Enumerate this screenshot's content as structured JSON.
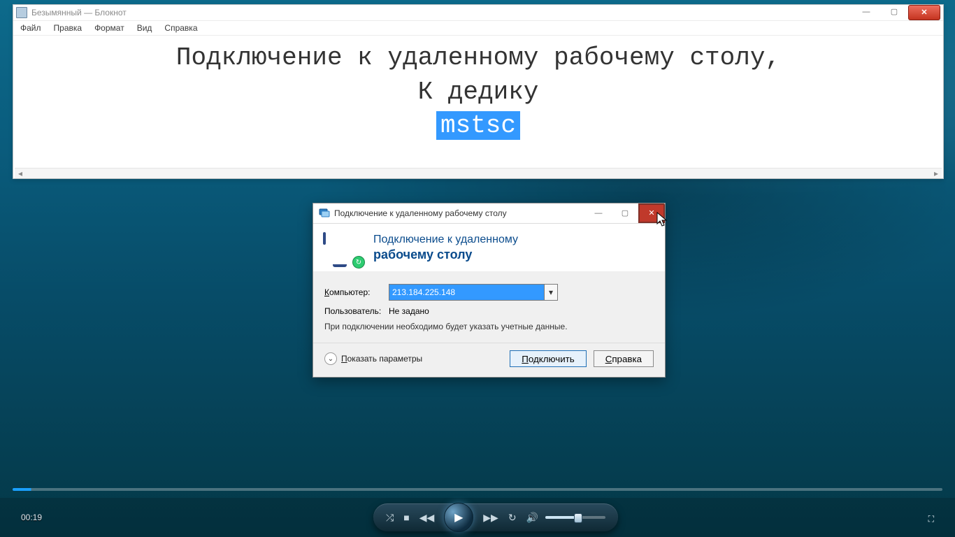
{
  "notepad": {
    "title": "Безымянный — Блокнот",
    "menu": {
      "file": "Файл",
      "edit": "Правка",
      "format": "Формат",
      "view": "Вид",
      "help": "Справка"
    },
    "content_line1": "Подключение к удаленному рабочему столу,",
    "content_line2": "К дедику",
    "content_selected": "mstsc"
  },
  "rdp": {
    "title": "Подключение к удаленному рабочему столу",
    "heading_line1": "Подключение к удаленному",
    "heading_line2": "рабочему столу",
    "computer_label": "Компьютер:",
    "computer_value": "213.184.225.148",
    "user_label": "Пользователь:",
    "user_value": "Не задано",
    "hint": "При подключении необходимо будет указать учетные данные.",
    "show_options": "Показать параметры",
    "connect": "Подключить",
    "help": "Справка"
  },
  "player": {
    "time": "00:19"
  },
  "icons": {
    "min": "—",
    "max": "▢",
    "close": "✕",
    "caret_down": "▾",
    "chev_down": "⌄",
    "shuffle": "⤮",
    "stop": "■",
    "prev": "◀◀",
    "play": "▶",
    "next": "▶▶",
    "repeat": "↻",
    "volume": "🔊",
    "fullscreen": "⛶",
    "screen_badge": "↻"
  }
}
